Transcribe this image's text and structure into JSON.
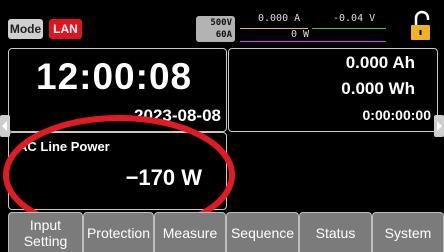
{
  "status_bar": {
    "mode_label": "Mode",
    "lan_label": "LAN",
    "voltage_range": "500V",
    "current_range": "60A",
    "measured_current": "0.000 A",
    "measured_voltage": "-0.04 V",
    "measured_power": "0 W"
  },
  "clock": {
    "time": "12:00:08",
    "date": "2023-08-08"
  },
  "energy": {
    "amp_hours": "0.000 Ah",
    "watt_hours": "0.000 Wh",
    "elapsed": "0:00:00:00"
  },
  "ac_line": {
    "title": "AC Line Power",
    "value": "−170 W"
  },
  "tabs": [
    {
      "label": "Input\nSetting"
    },
    {
      "label": "Protection"
    },
    {
      "label": "Measure"
    },
    {
      "label": "Sequence"
    },
    {
      "label": "Status"
    },
    {
      "label": "System"
    }
  ],
  "colors": {
    "lan_badge": "#e0141e",
    "lock_icon": "#f2b21c",
    "annotation_circle": "#e11b22",
    "tab_background": "#7b7b7b"
  }
}
